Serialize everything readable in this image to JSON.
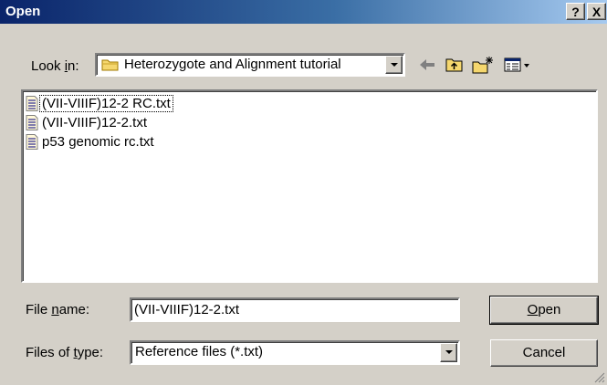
{
  "window": {
    "title": "Open",
    "help_glyph": "?",
    "close_glyph": "X"
  },
  "lookin": {
    "label_pre": "Look ",
    "label_accel": "i",
    "label_post": "n:",
    "folder": "Heterozygote and Alignment tutorial",
    "folder_icon": "folder-icon"
  },
  "toolbar": {
    "back_icon": "back-arrow-icon",
    "up_icon": "up-one-level-icon",
    "newfolder_icon": "new-folder-icon",
    "views_icon": "view-menu-icon"
  },
  "files": [
    {
      "name": "(VII-VIIIF)12-2 RC.txt",
      "icon": "text-file-icon"
    },
    {
      "name": "(VII-VIIIF)12-2.txt",
      "icon": "text-file-icon"
    },
    {
      "name": "p53 genomic rc.txt",
      "icon": "text-file-icon"
    }
  ],
  "filename": {
    "label_pre": "File ",
    "label_accel": "n",
    "label_post": "ame:",
    "value": "(VII-VIIIF)12-2.txt"
  },
  "filetype": {
    "label_pre": "Files of ",
    "label_accel": "t",
    "label_post": "ype:",
    "value": "Reference files (*.txt)"
  },
  "buttons": {
    "open_accel": "O",
    "open_rest": "pen",
    "cancel": "Cancel"
  },
  "colors": {
    "face": "#d4d0c8",
    "title_start": "#0a246a",
    "title_end": "#a6caf0"
  }
}
